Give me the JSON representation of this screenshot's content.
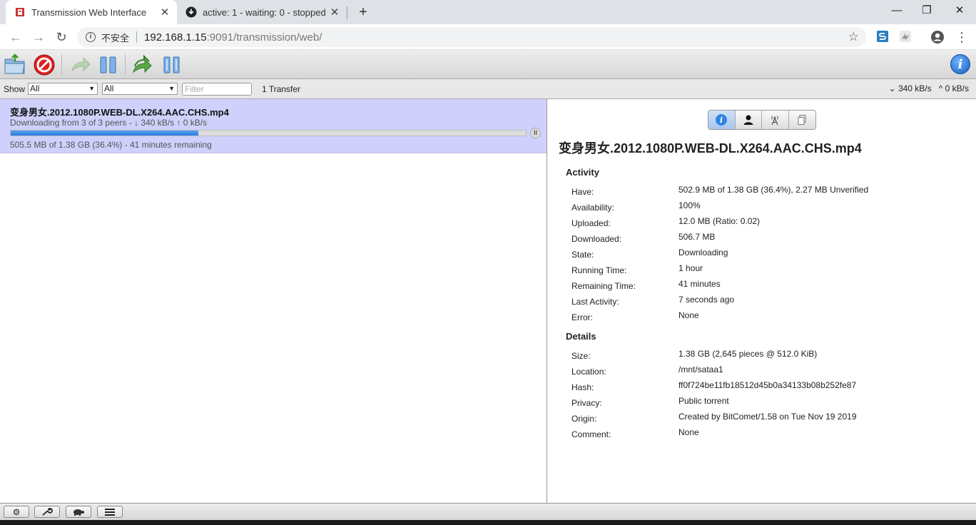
{
  "browser": {
    "tabs": [
      {
        "title": "Transmission Web Interface",
        "active": true
      },
      {
        "title": "active: 1 - waiting: 0 - stopped",
        "active": false
      }
    ],
    "window_controls": {
      "minimize": "—",
      "restore": "❐",
      "close": "✕"
    },
    "address": {
      "security_label": "不安全",
      "host": "192.168.1.15",
      "path": ":9091/transmission/web/"
    },
    "colors": {
      "tab_strip": "#dee1e6",
      "omnibox": "#f1f3f4"
    }
  },
  "toolbar": {
    "buttons": [
      "open-torrent",
      "remove-torrent",
      "resume",
      "pause",
      "resume-all",
      "pause-all"
    ],
    "info_label": "i"
  },
  "filterbar": {
    "show_label": "Show",
    "status_filter": "All",
    "tracker_filter": "All",
    "filter_placeholder": "Filter",
    "transfer_count": "1 Transfer",
    "download_speed": "340 kB/s",
    "upload_speed": "0 kB/s"
  },
  "torrent": {
    "name": "变身男女.2012.1080P.WEB-DL.X264.AAC.CHS.mp4",
    "peers_status": "Downloading from 3 of 3 peers - ↓ 340 kB/s ↑ 0 kB/s",
    "progress_text": "505.5 MB of 1.38 GB (36.4%) - 41 minutes remaining",
    "progress_fraction": 0.364,
    "selected_color": "#cfd0fb"
  },
  "inspector": {
    "title": "变身男女.2012.1080P.WEB-DL.X264.AAC.CHS.mp4",
    "tabs": [
      "info",
      "peers",
      "trackers",
      "files"
    ],
    "activity": {
      "heading": "Activity",
      "rows": [
        {
          "label": "Have:",
          "value": "502.9 MB of 1.38 GB (36.4%), 2.27 MB Unverified"
        },
        {
          "label": "Availability:",
          "value": "100%"
        },
        {
          "label": "Uploaded:",
          "value": "12.0 MB (Ratio: 0.02)"
        },
        {
          "label": "Downloaded:",
          "value": "506.7 MB"
        },
        {
          "label": "State:",
          "value": "Downloading"
        },
        {
          "label": "Running Time:",
          "value": "1 hour"
        },
        {
          "label": "Remaining Time:",
          "value": "41 minutes"
        },
        {
          "label": "Last Activity:",
          "value": "7 seconds ago"
        },
        {
          "label": "Error:",
          "value": "None"
        }
      ]
    },
    "details": {
      "heading": "Details",
      "rows": [
        {
          "label": "Size:",
          "value": "1.38 GB (2,645 pieces @ 512.0 KiB)"
        },
        {
          "label": "Location:",
          "value": "/mnt/sataa1"
        },
        {
          "label": "Hash:",
          "value": "ff0f724be11fb18512d45b0a34133b08b252fe87"
        },
        {
          "label": "Privacy:",
          "value": "Public torrent"
        },
        {
          "label": "Origin:",
          "value": "Created by BitComet/1.58 on Tue Nov 19 2019"
        },
        {
          "label": "Comment:",
          "value": "None"
        }
      ]
    }
  },
  "bottombar": {
    "buttons": [
      "settings",
      "preferences",
      "turtle-mode",
      "sort-options"
    ]
  }
}
